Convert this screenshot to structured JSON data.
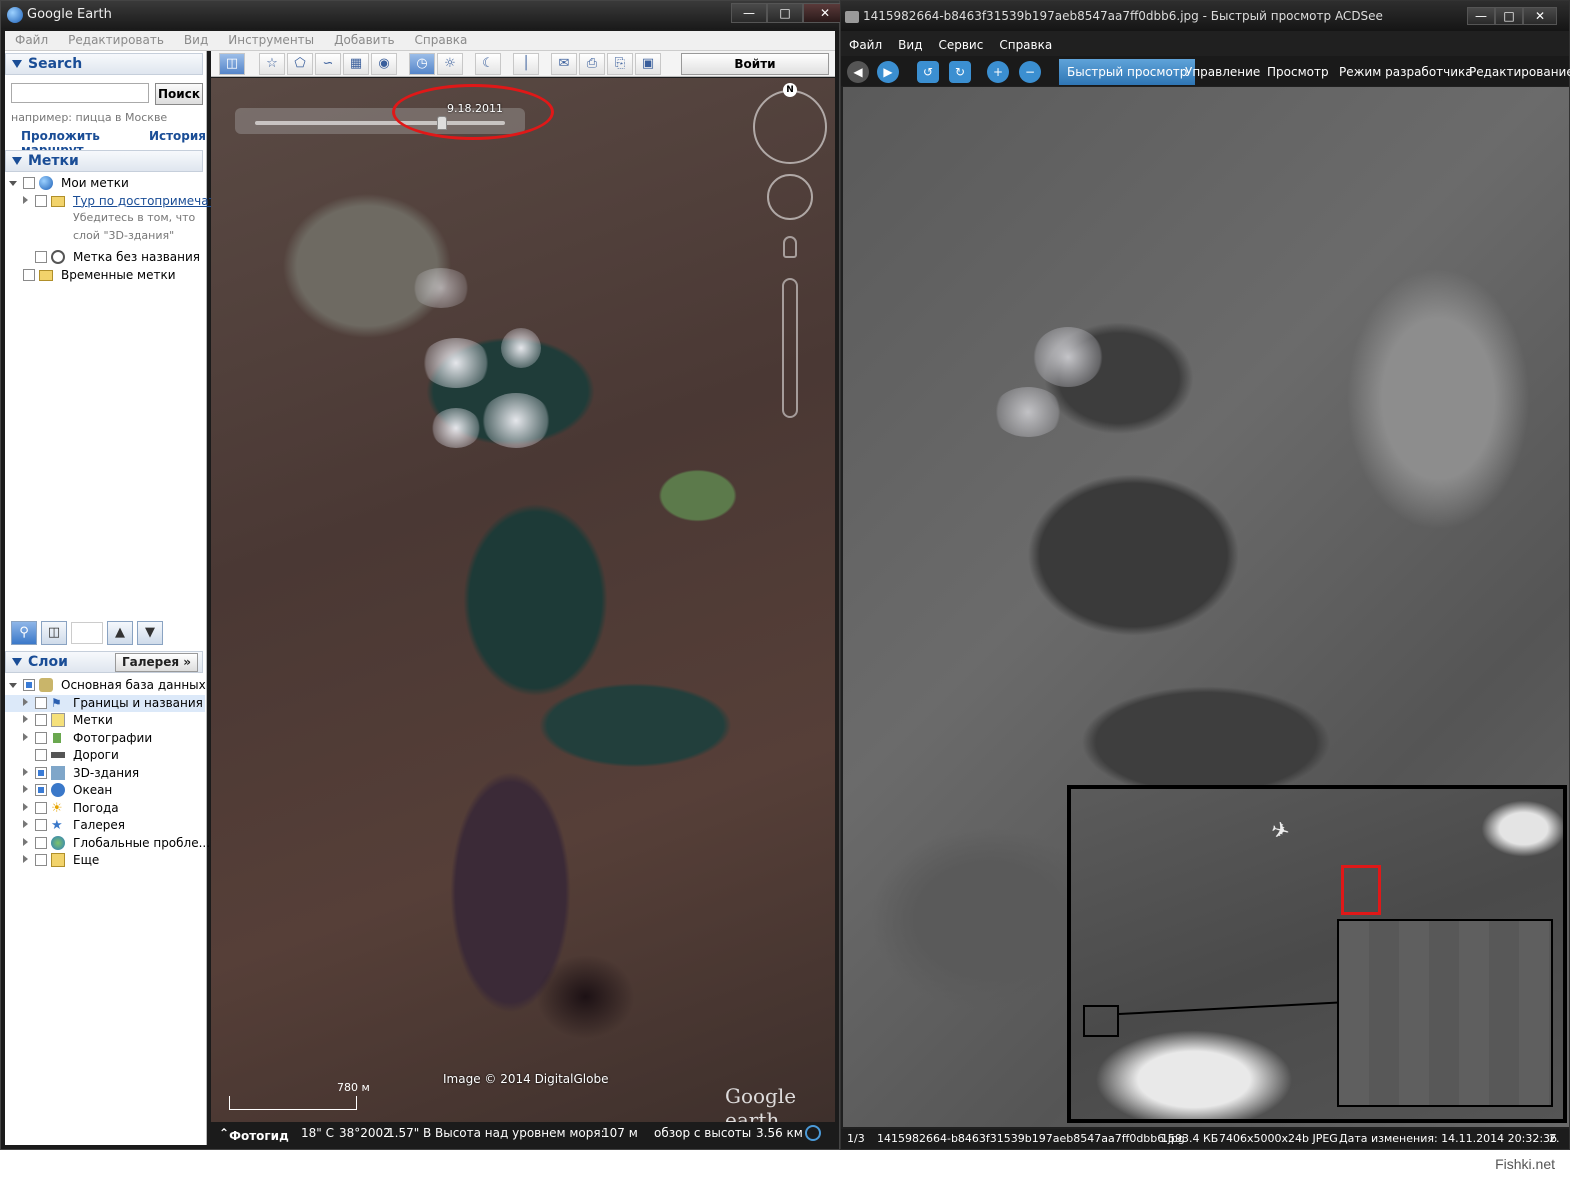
{
  "google_earth": {
    "title": "Google Earth",
    "menu": [
      "Файл",
      "Редактировать",
      "Вид",
      "Инструменты",
      "Добавить",
      "Справка"
    ],
    "search": {
      "header": "Search",
      "placeholder": "",
      "button": "Поиск",
      "hint": "например: пицца в Москве",
      "route_link": "Проложить маршрут",
      "history_link": "История"
    },
    "places": {
      "header": "Метки",
      "items": [
        {
          "label": "Мои метки"
        },
        {
          "label": "Тур по достопримечате..."
        },
        {
          "label": "Убедитесь в том, что"
        },
        {
          "label": "слой \"3D-здания\""
        },
        {
          "label": "Метка без названия"
        },
        {
          "label": "Временные метки"
        }
      ]
    },
    "layers": {
      "header": "Слои",
      "gallery_button": "Галерея",
      "items": [
        {
          "label": "Основная база данных"
        },
        {
          "label": "Границы и названия"
        },
        {
          "label": "Метки"
        },
        {
          "label": "Фотографии"
        },
        {
          "label": "Дороги"
        },
        {
          "label": "3D-здания"
        },
        {
          "label": "Океан"
        },
        {
          "label": "Погода"
        },
        {
          "label": "Галерея"
        },
        {
          "label": "Глобальные пробле..."
        },
        {
          "label": "Еще"
        }
      ]
    },
    "toolbar": {
      "login": "Войти"
    },
    "map": {
      "slider_date": "9.18.2011",
      "compass_letter": "N",
      "scale_label": "780 м",
      "imagery_credit": "Image © 2014 DigitalGlobe",
      "logo": "Google earth"
    },
    "status": {
      "tour_guide": "Фотогид",
      "coord_lat": "18\" С",
      "coord_year": "38°2002",
      "coord_lon": "1.57\" В",
      "elevation_label": "Высота над уровнем моря:",
      "elevation_value": "107 м",
      "eye_alt_label": "обзор с высоты",
      "eye_alt_value": "3.56 км"
    }
  },
  "acdsee": {
    "title": "1415982664-b8463f31539b197aeb8547aa7ff0dbb6.jpg - Быстрый просмотр ACDSee",
    "menu": [
      "Файл",
      "Вид",
      "Сервис",
      "Справка"
    ],
    "tabs": [
      "Быстрый просмотр",
      "Управление",
      "Просмотр",
      "Режим разработчика",
      "Редактирование"
    ],
    "active_tab": 0,
    "status": {
      "index": "1/3",
      "filename": "1415982664-b8463f31539b197aeb8547aa7ff0dbb6.jpg",
      "size": "1593.4 КБ",
      "dimensions": "7406x5000x24b JPEG",
      "modified": "Дата изменения: 14.11.2014 20:32:36",
      "extra": "2."
    }
  },
  "watermark": "Fishki.net",
  "colors": {
    "highlight_red": "#e01818",
    "acd_tab_active": "#3a86c6",
    "ge_link": "#1a4d96"
  }
}
